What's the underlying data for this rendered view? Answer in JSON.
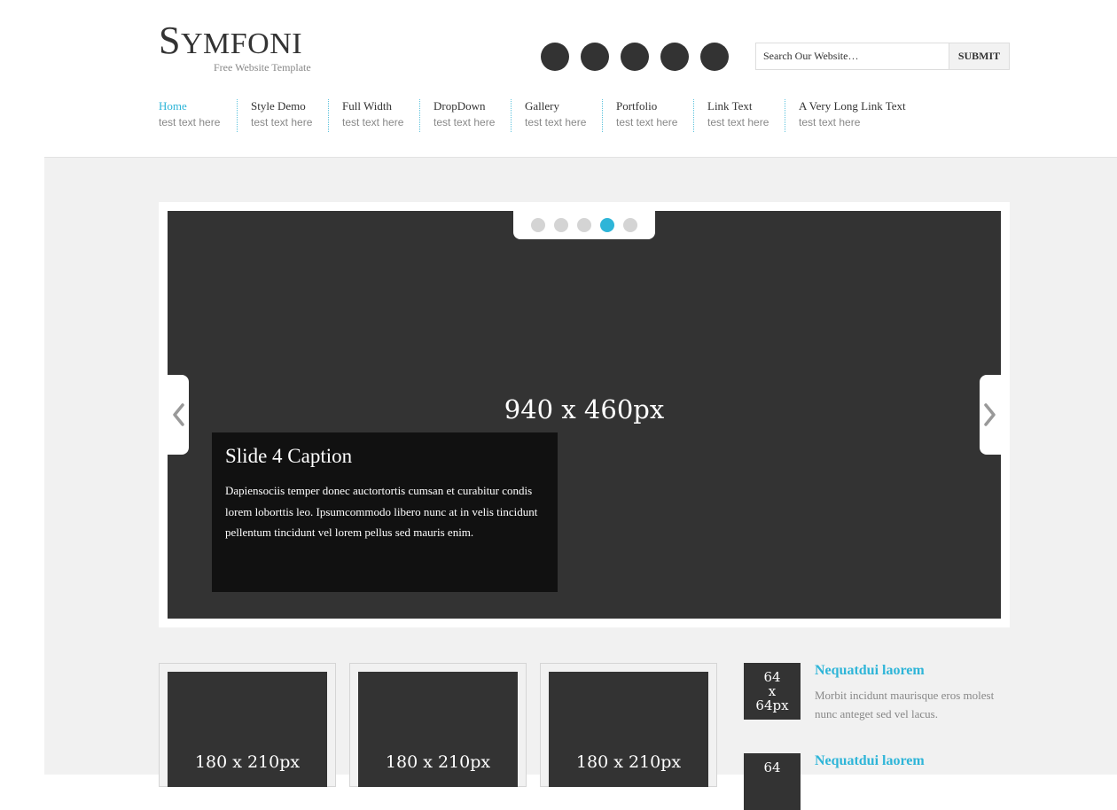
{
  "header": {
    "logo_first": "S",
    "logo_rest": "YMFONI",
    "tagline": "Free Website Template",
    "social_icons": [
      "social-icon-1",
      "social-icon-2",
      "social-icon-3",
      "social-icon-4",
      "social-icon-5"
    ],
    "search": {
      "placeholder": "Search Our Website…",
      "value": "",
      "button": "SUBMIT"
    }
  },
  "nav": [
    {
      "label": "Home",
      "sub": "test text here",
      "active": true
    },
    {
      "label": "Style Demo",
      "sub": "test text here"
    },
    {
      "label": "Full Width",
      "sub": "test text here"
    },
    {
      "label": "DropDown",
      "sub": "test text here"
    },
    {
      "label": "Gallery",
      "sub": "test text here"
    },
    {
      "label": "Portfolio",
      "sub": "test text here"
    },
    {
      "label": "Link Text",
      "sub": "test text here"
    },
    {
      "label": "A Very Long Link Text",
      "sub": "test text here"
    }
  ],
  "slider": {
    "size_label": "940 x 460px",
    "caption_title": "Slide 4 Caption",
    "caption_text": "Dapiensociis temper donec auctortortis cumsan et curabitur condis lorem loborttis leo. Ipsumcommodo libero nunc at in velis tincidunt pellentum tincidunt vel lorem pellus sed mauris enim.",
    "pager_count": 5,
    "active_index": 4,
    "prev_icon": "chevron-left-icon",
    "next_icon": "chevron-right-icon"
  },
  "thumbs": [
    {
      "label": "180 x 210px"
    },
    {
      "label": "180 x 210px"
    },
    {
      "label": "180 x 210px"
    }
  ],
  "side": [
    {
      "img_l1": "64",
      "img_l2": "x",
      "img_l3": "64px",
      "title": "Nequatdui laorem",
      "text": "Morbit incidunt maurisque eros molest nunc anteget sed vel lacus."
    },
    {
      "img_l1": "64",
      "img_l2": "",
      "img_l3": "",
      "title": "Nequatdui laorem",
      "text": ""
    }
  ],
  "colors": {
    "accent": "#2eb5d8",
    "dark": "#333333",
    "content_bg": "#f1f1f1"
  }
}
